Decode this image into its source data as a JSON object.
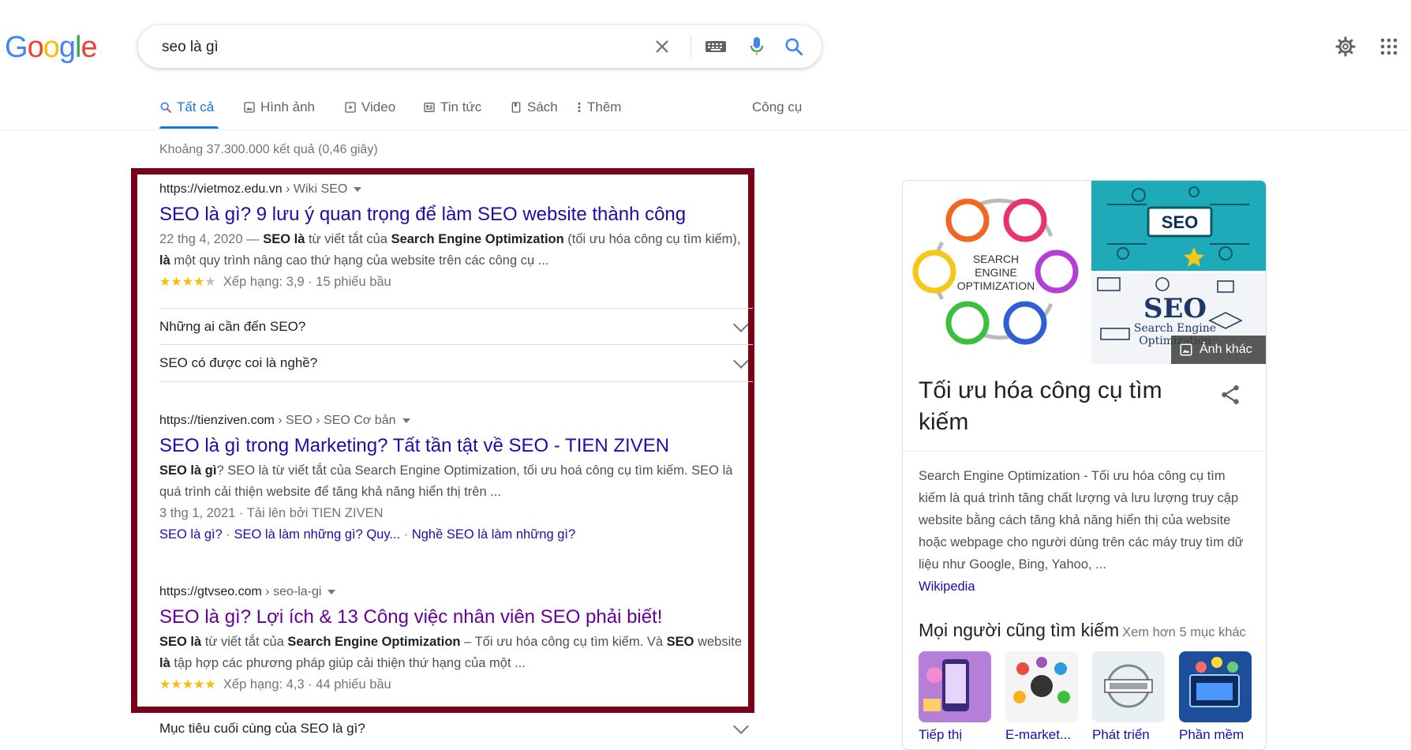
{
  "search": {
    "query": "seo là gì"
  },
  "logo": {
    "text": "Google"
  },
  "tabs": [
    {
      "label": "Tất cả",
      "icon": "search-icon"
    },
    {
      "label": "Hình ảnh",
      "icon": "image-icon"
    },
    {
      "label": "Video",
      "icon": "video-icon"
    },
    {
      "label": "Tin tức",
      "icon": "news-icon"
    },
    {
      "label": "Sách",
      "icon": "book-icon"
    },
    {
      "label": "Thêm",
      "icon": "more-vert-icon"
    },
    {
      "label": "Công cụ",
      "icon": ""
    }
  ],
  "stats": "Khoảng 37.300.000 kết quả (0,46 giây)",
  "results": [
    {
      "domain": "https://vietmoz.edu.vn",
      "path": " › Wiki SEO",
      "title": "SEO là gì? 9 lưu ý quan trọng để làm SEO website thành công",
      "date": "22 thg 4, 2020 — ",
      "snippet_b1": "SEO là",
      "snippet_t1": " từ viết tắt của ",
      "snippet_b2": "Search Engine Optimization",
      "snippet_t2": " (tối ưu hóa công cụ tìm kiếm), ",
      "snippet_b3": "là",
      "snippet_t3": " một quy trình nâng cao thứ hạng của website trên các công cụ ...",
      "stars": 4,
      "rating": "Xếp hạng: 3,9 · 15 phiếu bầu"
    },
    {
      "domain": "https://tienziven.com",
      "path": " › SEO › SEO Cơ bản",
      "title": "SEO là gì trong Marketing? Tất tần tật về SEO - TIEN ZIVEN",
      "snippet_b1": "SEO là gì",
      "snippet_t1": "? SEO là từ viết tắt của Search Engine Optimization, tối ưu hoá công cụ tìm kiếm. SEO là quá trình cải thiện website để tăng khả năng hiển thị trên ...",
      "meta": "3 thg 1, 2021 · Tải lên bởi TIEN ZIVEN",
      "sitelinks": [
        "SEO là gì?",
        "SEO là làm những gì? Quy...",
        "Nghề SEO là làm những gì?"
      ]
    },
    {
      "domain": "https://gtvseo.com",
      "path": " › seo-la-gi",
      "title": "SEO là gì? Lợi ích & 13 Công việc nhân viên SEO phải biết!",
      "snippet_b1": "SEO là",
      "snippet_t1": " từ viết tắt của ",
      "snippet_b2": "Search Engine Optimization",
      "snippet_t2": " – Tối ưu hóa công cụ tìm kiếm. Và ",
      "snippet_b3": "SEO",
      "snippet_t3": " website ",
      "snippet_b4": "là",
      "snippet_t4": " tập hợp các phương pháp giúp cải thiện thứ hạng của một ...",
      "stars": 5,
      "rating": "Xếp hạng: 4,3 · 44 phiếu bầu"
    }
  ],
  "paa": [
    "Những ai cần đến SEO?",
    "SEO có được coi là nghề?",
    "Mục tiêu cuối cùng của SEO là gì?"
  ],
  "knowledge_panel": {
    "title": "Tối ưu hóa công cụ tìm kiếm",
    "more_images": "Ảnh khác",
    "img_main_text": [
      "SEARCH",
      "ENGINE",
      "OPTIMIZATION"
    ],
    "img_tr_text": "SEO",
    "img_br_text": [
      "SEO",
      "Search Engine",
      "Optimization"
    ],
    "desc": "Search Engine Optimization - Tối ưu hóa công cụ tìm kiếm là quá trình tăng chất lượng và lưu lượng truy cập website bằng cách tăng khả năng hiển thị của website hoặc webpage cho người dùng trên các máy truy tìm dữ liệu như Google, Bing, Yahoo, ...",
    "source": "Wikipedia",
    "also_search_title": "Mọi người cũng tìm kiếm",
    "also_search_more": "Xem hơn 5 mục khác",
    "also_items": [
      {
        "label": "Tiếp thị",
        "color": "#b57fd9"
      },
      {
        "label": "E-market...",
        "color": "#f4f4f4"
      },
      {
        "label": "Phát triển",
        "color": "#e9f0f3"
      },
      {
        "label": "Phần mềm",
        "color": "#1e4f9a"
      }
    ]
  },
  "colors": {
    "link": "#1a0dab",
    "visited": "#660099",
    "accent": "#1a73e8",
    "highlight_border": "#7a0019"
  }
}
